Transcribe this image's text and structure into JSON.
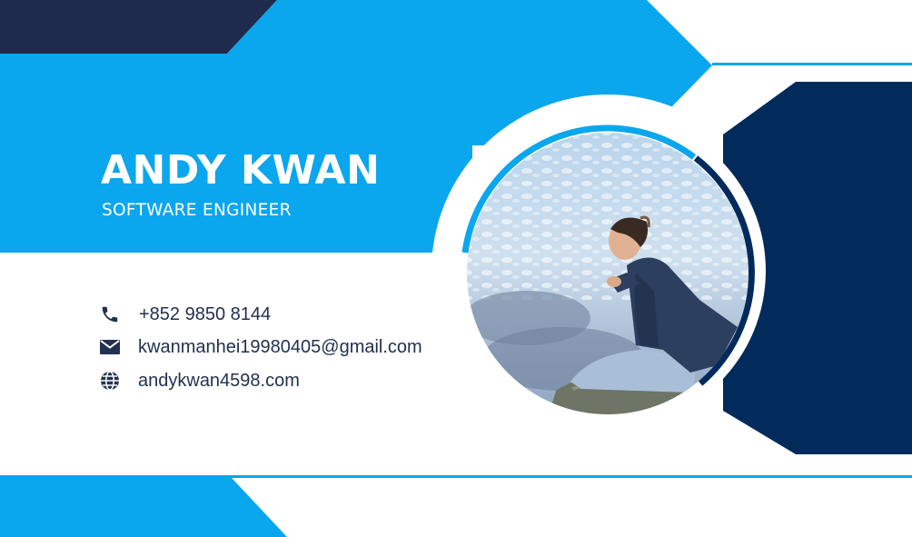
{
  "card": {
    "name": "ANDY KWAN",
    "title": "SOFTWARE ENGINEER",
    "photo_alt": "Portrait photo",
    "contacts": [
      {
        "icon": "phone-icon",
        "text": "+852 9850 8144"
      },
      {
        "icon": "mail-icon",
        "text": "kwanmanhei19980405@gmail.com"
      },
      {
        "icon": "globe-icon",
        "text": "andykwan4598.com"
      }
    ]
  },
  "colors": {
    "light_blue": "#0aa6ee",
    "navy": "#022b5c",
    "dark_navy": "#1f2b4c",
    "text": "#22314f",
    "white": "#ffffff"
  }
}
